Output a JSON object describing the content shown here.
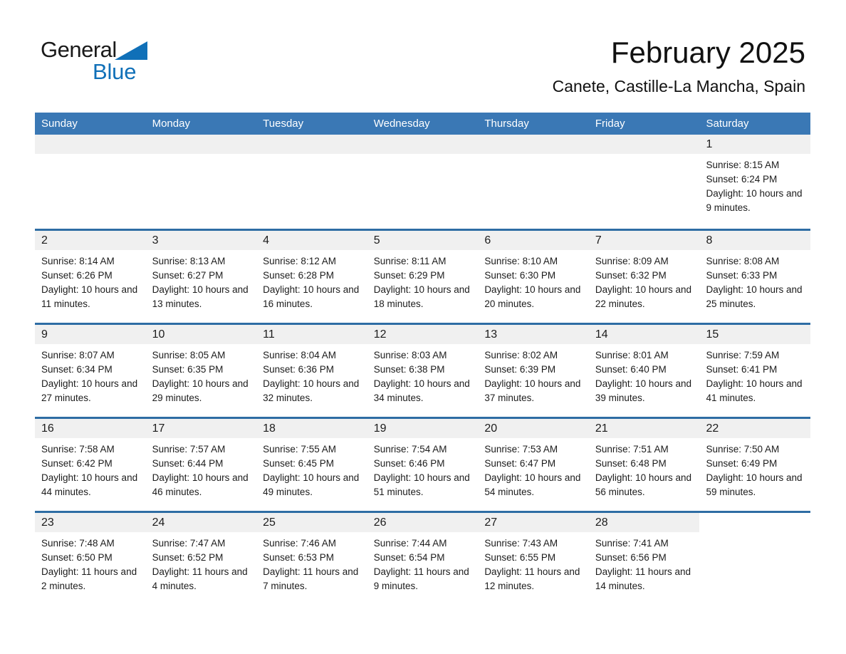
{
  "brand": {
    "name_part1": "General",
    "name_part2": "Blue",
    "logo_icon": "triangle-logo-icon",
    "accent_color": "#1070b8"
  },
  "header": {
    "title": "February 2025",
    "subtitle": "Canete, Castille-La Mancha, Spain"
  },
  "theme": {
    "header_blue": "#3a78b5",
    "divider_blue": "#2e6da4",
    "day_band_gray": "#f0f0f0"
  },
  "weekdays": [
    "Sunday",
    "Monday",
    "Tuesday",
    "Wednesday",
    "Thursday",
    "Friday",
    "Saturday"
  ],
  "weeks": [
    [
      {
        "day": "",
        "empty": true
      },
      {
        "day": "",
        "empty": true
      },
      {
        "day": "",
        "empty": true
      },
      {
        "day": "",
        "empty": true
      },
      {
        "day": "",
        "empty": true
      },
      {
        "day": "",
        "empty": true
      },
      {
        "day": "1",
        "sunrise": "Sunrise: 8:15 AM",
        "sunset": "Sunset: 6:24 PM",
        "daylight": "Daylight: 10 hours and 9 minutes."
      }
    ],
    [
      {
        "day": "2",
        "sunrise": "Sunrise: 8:14 AM",
        "sunset": "Sunset: 6:26 PM",
        "daylight": "Daylight: 10 hours and 11 minutes."
      },
      {
        "day": "3",
        "sunrise": "Sunrise: 8:13 AM",
        "sunset": "Sunset: 6:27 PM",
        "daylight": "Daylight: 10 hours and 13 minutes."
      },
      {
        "day": "4",
        "sunrise": "Sunrise: 8:12 AM",
        "sunset": "Sunset: 6:28 PM",
        "daylight": "Daylight: 10 hours and 16 minutes."
      },
      {
        "day": "5",
        "sunrise": "Sunrise: 8:11 AM",
        "sunset": "Sunset: 6:29 PM",
        "daylight": "Daylight: 10 hours and 18 minutes."
      },
      {
        "day": "6",
        "sunrise": "Sunrise: 8:10 AM",
        "sunset": "Sunset: 6:30 PM",
        "daylight": "Daylight: 10 hours and 20 minutes."
      },
      {
        "day": "7",
        "sunrise": "Sunrise: 8:09 AM",
        "sunset": "Sunset: 6:32 PM",
        "daylight": "Daylight: 10 hours and 22 minutes."
      },
      {
        "day": "8",
        "sunrise": "Sunrise: 8:08 AM",
        "sunset": "Sunset: 6:33 PM",
        "daylight": "Daylight: 10 hours and 25 minutes."
      }
    ],
    [
      {
        "day": "9",
        "sunrise": "Sunrise: 8:07 AM",
        "sunset": "Sunset: 6:34 PM",
        "daylight": "Daylight: 10 hours and 27 minutes."
      },
      {
        "day": "10",
        "sunrise": "Sunrise: 8:05 AM",
        "sunset": "Sunset: 6:35 PM",
        "daylight": "Daylight: 10 hours and 29 minutes."
      },
      {
        "day": "11",
        "sunrise": "Sunrise: 8:04 AM",
        "sunset": "Sunset: 6:36 PM",
        "daylight": "Daylight: 10 hours and 32 minutes."
      },
      {
        "day": "12",
        "sunrise": "Sunrise: 8:03 AM",
        "sunset": "Sunset: 6:38 PM",
        "daylight": "Daylight: 10 hours and 34 minutes."
      },
      {
        "day": "13",
        "sunrise": "Sunrise: 8:02 AM",
        "sunset": "Sunset: 6:39 PM",
        "daylight": "Daylight: 10 hours and 37 minutes."
      },
      {
        "day": "14",
        "sunrise": "Sunrise: 8:01 AM",
        "sunset": "Sunset: 6:40 PM",
        "daylight": "Daylight: 10 hours and 39 minutes."
      },
      {
        "day": "15",
        "sunrise": "Sunrise: 7:59 AM",
        "sunset": "Sunset: 6:41 PM",
        "daylight": "Daylight: 10 hours and 41 minutes."
      }
    ],
    [
      {
        "day": "16",
        "sunrise": "Sunrise: 7:58 AM",
        "sunset": "Sunset: 6:42 PM",
        "daylight": "Daylight: 10 hours and 44 minutes."
      },
      {
        "day": "17",
        "sunrise": "Sunrise: 7:57 AM",
        "sunset": "Sunset: 6:44 PM",
        "daylight": "Daylight: 10 hours and 46 minutes."
      },
      {
        "day": "18",
        "sunrise": "Sunrise: 7:55 AM",
        "sunset": "Sunset: 6:45 PM",
        "daylight": "Daylight: 10 hours and 49 minutes."
      },
      {
        "day": "19",
        "sunrise": "Sunrise: 7:54 AM",
        "sunset": "Sunset: 6:46 PM",
        "daylight": "Daylight: 10 hours and 51 minutes."
      },
      {
        "day": "20",
        "sunrise": "Sunrise: 7:53 AM",
        "sunset": "Sunset: 6:47 PM",
        "daylight": "Daylight: 10 hours and 54 minutes."
      },
      {
        "day": "21",
        "sunrise": "Sunrise: 7:51 AM",
        "sunset": "Sunset: 6:48 PM",
        "daylight": "Daylight: 10 hours and 56 minutes."
      },
      {
        "day": "22",
        "sunrise": "Sunrise: 7:50 AM",
        "sunset": "Sunset: 6:49 PM",
        "daylight": "Daylight: 10 hours and 59 minutes."
      }
    ],
    [
      {
        "day": "23",
        "sunrise": "Sunrise: 7:48 AM",
        "sunset": "Sunset: 6:50 PM",
        "daylight": "Daylight: 11 hours and 2 minutes."
      },
      {
        "day": "24",
        "sunrise": "Sunrise: 7:47 AM",
        "sunset": "Sunset: 6:52 PM",
        "daylight": "Daylight: 11 hours and 4 minutes."
      },
      {
        "day": "25",
        "sunrise": "Sunrise: 7:46 AM",
        "sunset": "Sunset: 6:53 PM",
        "daylight": "Daylight: 11 hours and 7 minutes."
      },
      {
        "day": "26",
        "sunrise": "Sunrise: 7:44 AM",
        "sunset": "Sunset: 6:54 PM",
        "daylight": "Daylight: 11 hours and 9 minutes."
      },
      {
        "day": "27",
        "sunrise": "Sunrise: 7:43 AM",
        "sunset": "Sunset: 6:55 PM",
        "daylight": "Daylight: 11 hours and 12 minutes."
      },
      {
        "day": "28",
        "sunrise": "Sunrise: 7:41 AM",
        "sunset": "Sunset: 6:56 PM",
        "daylight": "Daylight: 11 hours and 14 minutes."
      },
      {
        "day": "",
        "empty": true,
        "no_band": true
      }
    ]
  ]
}
